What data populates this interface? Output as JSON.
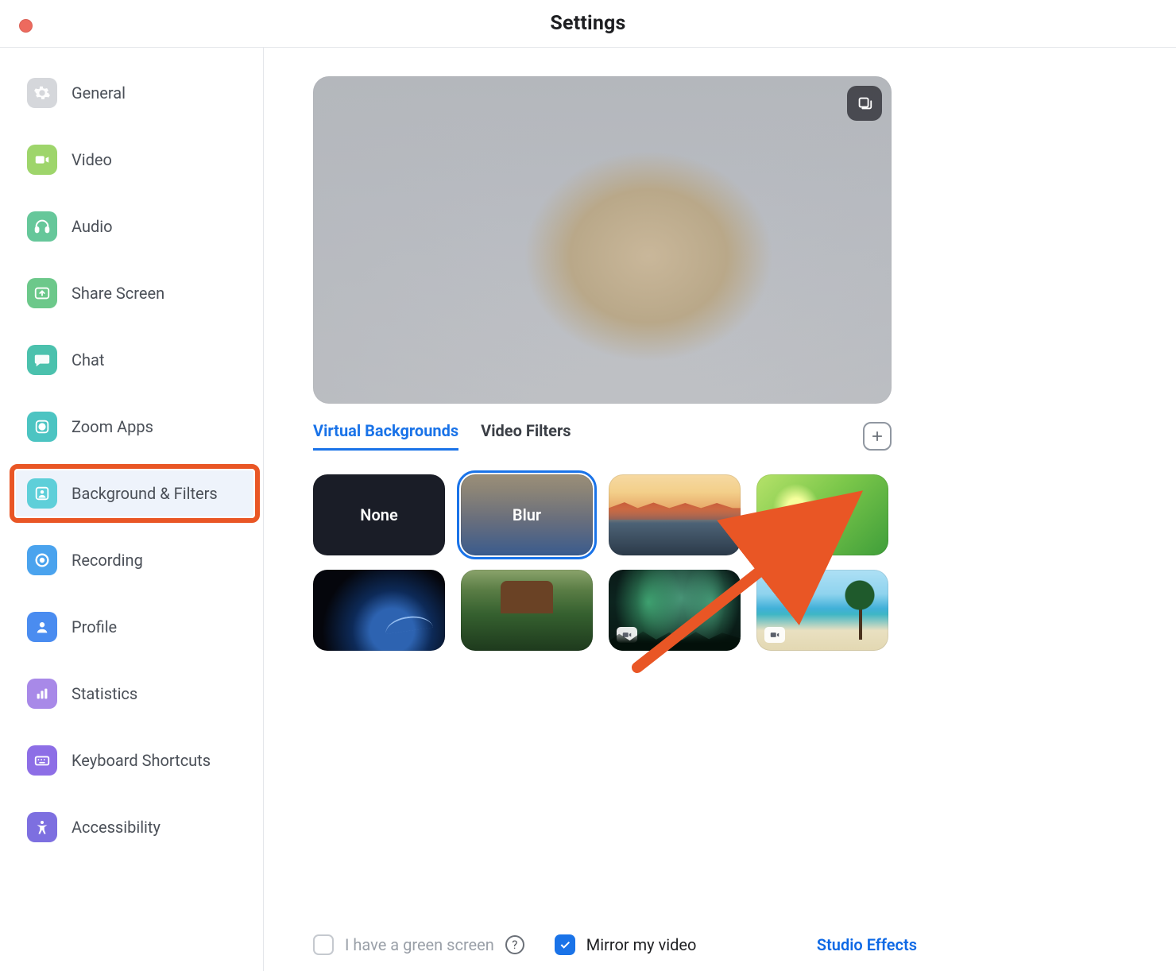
{
  "window": {
    "title": "Settings"
  },
  "sidebar": {
    "items": [
      {
        "label": "General"
      },
      {
        "label": "Video"
      },
      {
        "label": "Audio"
      },
      {
        "label": "Share Screen"
      },
      {
        "label": "Chat"
      },
      {
        "label": "Zoom Apps"
      },
      {
        "label": "Background & Filters"
      },
      {
        "label": "Recording"
      },
      {
        "label": "Profile"
      },
      {
        "label": "Statistics"
      },
      {
        "label": "Keyboard Shortcuts"
      },
      {
        "label": "Accessibility"
      }
    ],
    "active_index": 6
  },
  "tabs": {
    "items": [
      {
        "label": "Virtual Backgrounds"
      },
      {
        "label": "Video Filters"
      }
    ],
    "active_index": 0
  },
  "tiles": {
    "none_label": "None",
    "blur_label": "Blur",
    "selected_index": 1
  },
  "footer": {
    "green_screen_label": "I have a green screen",
    "green_screen_checked": false,
    "mirror_label": "Mirror my video",
    "mirror_checked": true,
    "studio_effects_label": "Studio Effects"
  },
  "annotation": {
    "sidebar_highlight_color": "#e95625",
    "arrow_color": "#e95625"
  }
}
